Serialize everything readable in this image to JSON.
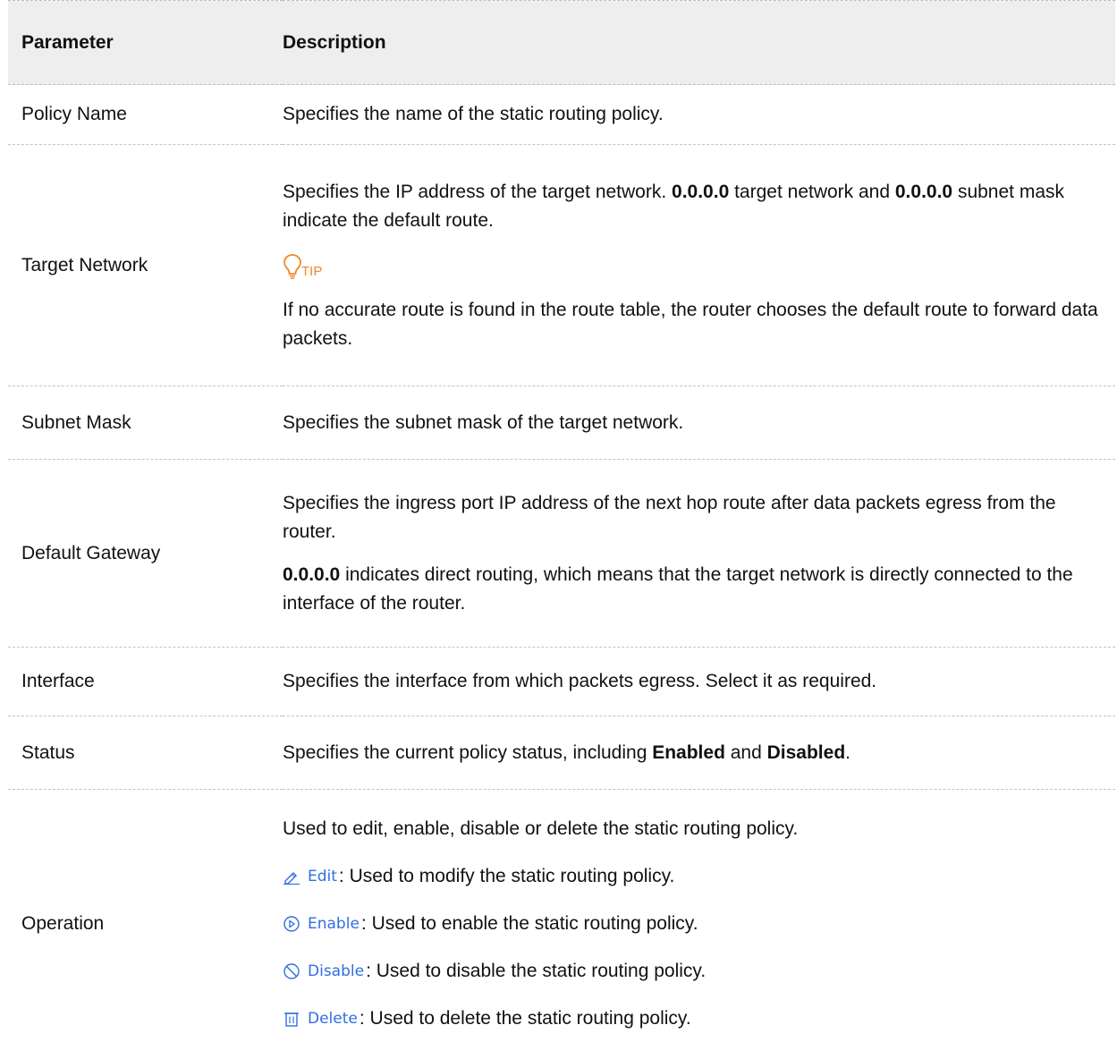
{
  "table": {
    "headers": {
      "param": "Parameter",
      "desc": "Description"
    },
    "rows": {
      "policy_name": {
        "param": "Policy Name",
        "desc": "Specifies the name of the static routing policy."
      },
      "target_network": {
        "param": "Target Network",
        "desc_a": "Specifies the IP address of the target network. ",
        "desc_b1": "0.0.0.0",
        "desc_c": " target network and ",
        "desc_b2": "0.0.0.0",
        "desc_d": " subnet mask indicate the default route.",
        "tip_label": "TIP",
        "tip_text": "If no accurate route is found in the route table, the router chooses the default route to forward data packets."
      },
      "subnet_mask": {
        "param": "Subnet Mask",
        "desc": "Specifies the subnet mask of the target network."
      },
      "default_gateway": {
        "param": "Default Gateway",
        "desc1": "Specifies the ingress port IP address of the next hop route after data packets egress from the router.",
        "desc2_bold": "0.0.0.0",
        "desc2_rest": " indicates direct routing, which means that the target network is directly connected to the interface of the router."
      },
      "interface": {
        "param": "Interface",
        "desc": "Specifies the interface from which packets egress. Select it as required."
      },
      "status": {
        "param": "Status",
        "desc_a": "Specifies the current policy status, including ",
        "enabled": "Enabled",
        "desc_b": " and ",
        "disabled": "Disabled",
        "desc_c": "."
      },
      "operation": {
        "param": "Operation",
        "intro": "Used to edit, enable, disable or delete the static routing policy.",
        "items": [
          {
            "label": "Edit",
            "icon": "pencil-icon",
            "desc": ": Used to modify the static routing policy."
          },
          {
            "label": "Enable",
            "icon": "play-circle-icon",
            "desc": ": Used to enable the static routing policy."
          },
          {
            "label": "Disable",
            "icon": "prohibit-icon",
            "desc": ": Used to disable the static routing policy."
          },
          {
            "label": "Delete",
            "icon": "trash-icon",
            "desc": ": Used to delete the static routing policy."
          }
        ]
      }
    }
  },
  "colors": {
    "header_bg": "#eeeeee",
    "action_blue": "#2f6fe0",
    "tip_orange": "#f08a24"
  }
}
